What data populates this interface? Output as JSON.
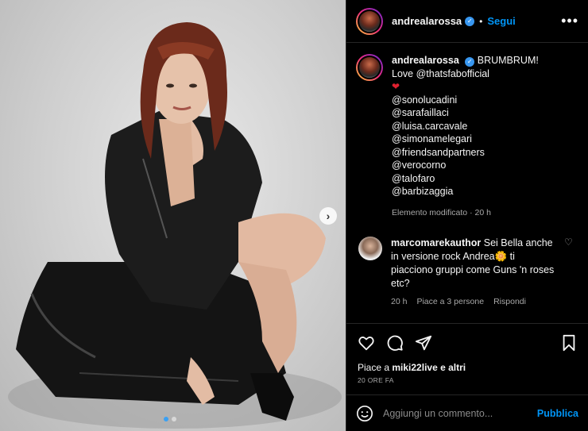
{
  "post": {
    "username": "andrealarossa",
    "verified_icon": "verified-badge-icon",
    "separator": "•",
    "follow_label": "Segui",
    "more_label": "•••"
  },
  "caption": {
    "username": "andrealarossa",
    "title": "BRUMBRUM!",
    "line1": "Love @thatsfabofficial",
    "heart": "❤",
    "mentions": [
      "@sonolucadini",
      "@sarafaillaci",
      "@luisa.carcavale",
      "@simonamelegari",
      "@friendsandpartners",
      "@verocorno",
      "@talofaro",
      "@barbizaggia"
    ],
    "edited_label": "Elemento modificato",
    "edited_sep": "·",
    "edited_time": "20 h"
  },
  "comment": {
    "username": "marcomarekauthor",
    "text": "Sei Bella anche in versione rock Andrea🌼 ti piacciono gruppi come Guns 'n roses etc?",
    "time": "20 h",
    "likes": "Piace a 3 persone",
    "reply": "Rispondi",
    "like_icon": "♡"
  },
  "engagement": {
    "likes_prefix": "Piace a",
    "likes_user": "miki22live",
    "likes_suffix": "e altri",
    "time_ago": "20 ORE FA"
  },
  "composer": {
    "emoji_icon": "☺",
    "placeholder": "Aggiungi un commento...",
    "publish_label": "Pubblica"
  },
  "carousel": {
    "next_arrow": "›",
    "active_index": 1,
    "total": 2
  },
  "colors": {
    "accent": "#0095f6",
    "background": "#000000",
    "heart": "#e0202f"
  }
}
